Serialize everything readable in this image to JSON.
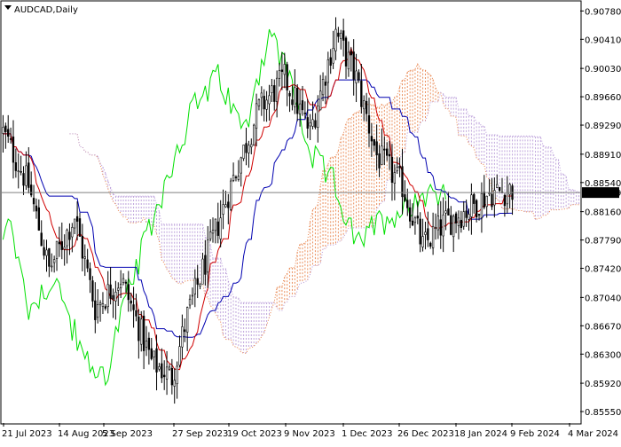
{
  "chart_data": {
    "type": "candlestick",
    "symbol": "AUDCAD",
    "timeframe": "Daily",
    "title": "AUDCAD,Daily",
    "ylim": [
      0.854,
      0.909
    ],
    "price_ticks": [
      "0.90780",
      "0.90410",
      "0.90030",
      "0.89660",
      "0.89290",
      "0.88910",
      "0.88540",
      "0.88160",
      "0.87790",
      "0.87420",
      "0.87040",
      "0.86670",
      "0.86300",
      "0.85920",
      "0.85550"
    ],
    "date_labels": [
      "21 Jul 2023",
      "14 Aug 2023",
      "5 Sep 2023",
      "27 Sep 2023",
      "19 Oct 2023",
      "9 Nov 2023",
      "1 Dec 2023",
      "26 Dec 2023",
      "18 Jan 2024",
      "9 Feb 2024",
      "4 Mar 2024"
    ],
    "current_price": 0.88409,
    "current_price_label": "0.88409",
    "indicator": "Ichimoku Kinko Hyo",
    "colors": {
      "bull_candle": "#ffffff",
      "bear_candle": "#000000",
      "candle_outline": "#000000",
      "tenkan": "#d00000",
      "kijun": "#0000b0",
      "chikou": "#00e000",
      "cloud_bull": "#e8824a",
      "cloud_bear": "#b89ad8",
      "price_line": "#808080",
      "price_label_bg": "#000000",
      "price_label_text": "#ffffff"
    }
  }
}
